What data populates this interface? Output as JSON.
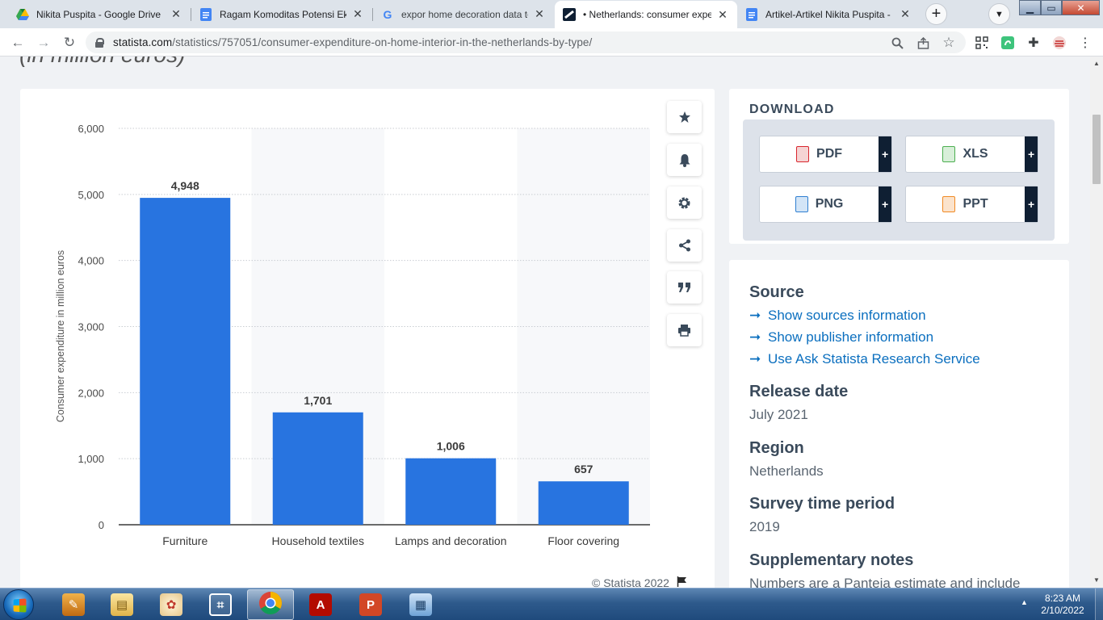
{
  "browser": {
    "tabs": [
      {
        "title": "Nikita Puspita - Google Drive",
        "icon": "google-drive-icon"
      },
      {
        "title": "Ragam Komoditas Potensi Eksp",
        "icon": "google-docs-icon"
      },
      {
        "title": "expor home decoration data to",
        "icon": "google-icon"
      },
      {
        "title": "• Netherlands: consumer expe",
        "icon": "statista-icon",
        "active": true
      },
      {
        "title": "Artikel-Artikel Nikita Puspita -",
        "icon": "google-docs-icon"
      }
    ],
    "url_host": "statista.com",
    "url_path": "/statistics/757051/consumer-expenditure-on-home-interior-in-the-netherlands-by-type/"
  },
  "page": {
    "heading_fragment": "(in million euros)",
    "copyright": "© Statista 2022"
  },
  "chart_data": {
    "type": "bar",
    "categories": [
      "Furniture",
      "Household textiles",
      "Lamps and decoration",
      "Floor covering"
    ],
    "values": [
      4948,
      1701,
      1006,
      657
    ],
    "value_labels": [
      "4,948",
      "1,701",
      "1,006",
      "657"
    ],
    "ylabel": "Consumer expenditure in million euros",
    "ylim": [
      0,
      6000
    ],
    "yticks": [
      0,
      1000,
      2000,
      3000,
      4000,
      5000,
      6000
    ],
    "ytick_labels": [
      "0",
      "1,000",
      "2,000",
      "3,000",
      "4,000",
      "5,000",
      "6,000"
    ],
    "grid": true,
    "bar_color": "#2874e0"
  },
  "download": {
    "title": "DOWNLOAD",
    "buttons": [
      {
        "label": "PDF",
        "icon": "pdf-file-icon",
        "color": "#d9262e"
      },
      {
        "label": "XLS",
        "icon": "xls-file-icon",
        "color": "#4caf50"
      },
      {
        "label": "PNG",
        "icon": "png-file-icon",
        "color": "#2f7fd1"
      },
      {
        "label": "PPT",
        "icon": "ppt-file-icon",
        "color": "#f08a24"
      }
    ],
    "plus": "+"
  },
  "info": {
    "source_heading": "Source",
    "links": [
      "Show sources information",
      "Show publisher information",
      "Use Ask Statista Research Service"
    ],
    "release_heading": "Release date",
    "release_value": "July 2021",
    "region_heading": "Region",
    "region_value": "Netherlands",
    "survey_heading": "Survey time period",
    "survey_value": "2019",
    "notes_heading": "Supplementary notes",
    "notes_value": "Numbers are a Panteia estimate and include"
  },
  "taskbar": {
    "time": "8:23 AM",
    "date": "2/10/2022"
  },
  "colors": {
    "accent": "#0b6fbf",
    "bar": "#2874e0",
    "heading": "#3a4a5b"
  }
}
